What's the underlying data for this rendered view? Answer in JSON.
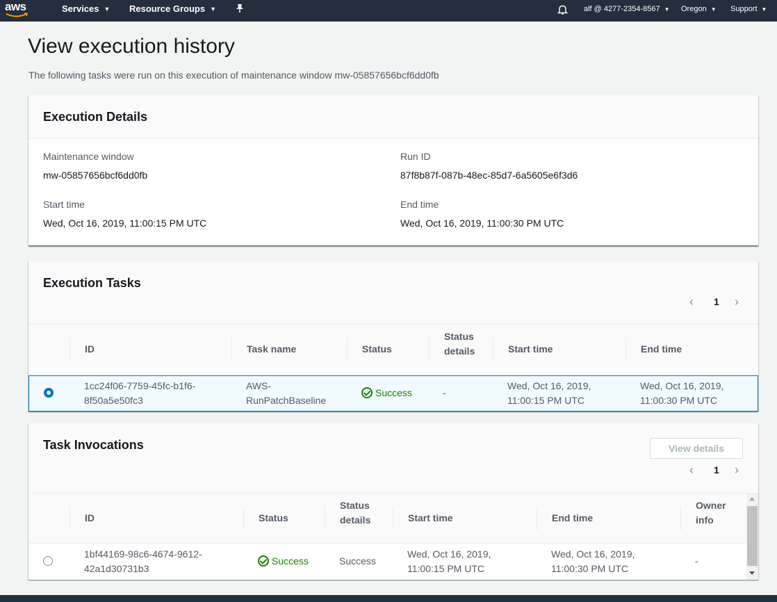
{
  "nav": {
    "logo": "aws",
    "services": "Services",
    "resource_groups": "Resource Groups",
    "account": "alf @ 4277-2354-8567",
    "region": "Oregon",
    "support": "Support"
  },
  "page": {
    "title": "View execution history",
    "description": "The following tasks were run on this execution of maintenance window mw-05857656bcf6dd0fb"
  },
  "execution_details": {
    "title": "Execution Details",
    "maintenance_window_label": "Maintenance window",
    "maintenance_window_value": "mw-05857656bcf6dd0fb",
    "run_id_label": "Run ID",
    "run_id_value": "87f8b87f-087b-48ec-85d7-6a5605e6f3d6",
    "start_time_label": "Start time",
    "start_time_value": "Wed, Oct 16, 2019, 11:00:15 PM UTC",
    "end_time_label": "End time",
    "end_time_value": "Wed, Oct 16, 2019, 11:00:30 PM UTC"
  },
  "execution_tasks": {
    "title": "Execution Tasks",
    "page": "1",
    "headers": {
      "id": "ID",
      "task_name": "Task name",
      "status": "Status",
      "status_details_1": "Status",
      "status_details_2": "details",
      "start_time": "Start time",
      "end_time": "End time"
    },
    "row": {
      "id_1": "1cc24f06-7759-45fc-b1f6-",
      "id_2": "8f50a5e50fc3",
      "task_name_1": "AWS-",
      "task_name_2": "RunPatchBaseline",
      "status": "Success",
      "status_details": "-",
      "start_1": "Wed, Oct 16, 2019,",
      "start_2": "11:00:15 PM UTC",
      "end_1": "Wed, Oct 16, 2019,",
      "end_2": "11:00:30 PM UTC",
      "selected": true
    }
  },
  "task_invocations": {
    "title": "Task Invocations",
    "view_details": "View details",
    "page": "1",
    "headers": {
      "id": "ID",
      "status": "Status",
      "status_details_1": "Status",
      "status_details_2": "details",
      "start_time": "Start time",
      "end_time": "End time",
      "owner_1": "Owner",
      "owner_2": "info"
    },
    "row": {
      "id_1": "1bf44169-98c6-4674-9612-",
      "id_2": "42a1d30731b3",
      "status": "Success",
      "status_details": "Success",
      "start_1": "Wed, Oct 16, 2019,",
      "start_2": "11:00:15 PM UTC",
      "end_1": "Wed, Oct 16, 2019,",
      "end_2": "11:00:30 PM UTC",
      "owner": "-",
      "selected": false
    }
  },
  "colors": {
    "nav_bg": "#232f3e",
    "success": "#1d8102",
    "selected_border": "#0073bb",
    "selected_bg": "#f1faff"
  }
}
